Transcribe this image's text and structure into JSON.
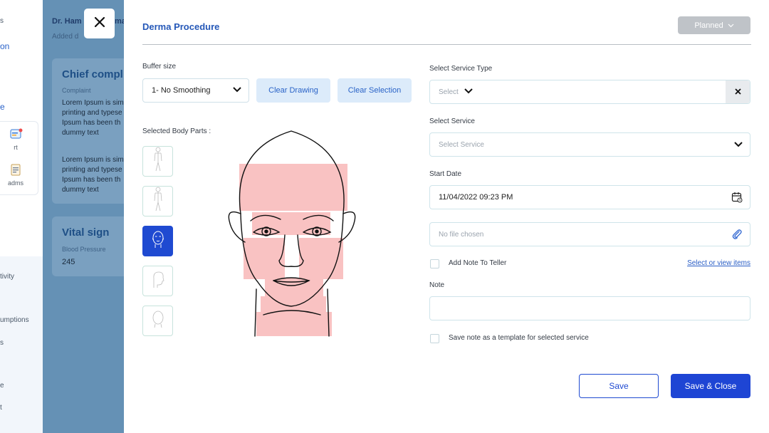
{
  "background": {
    "sidebar": {
      "fragments": [
        "s",
        "on",
        "e",
        "tivity",
        "umptions",
        "s",
        "e",
        "t"
      ],
      "items": [
        {
          "icon": "report-icon",
          "label": "rt"
        },
        {
          "icon": "document-icon",
          "label": "adms"
        }
      ]
    },
    "doctor_name": "Dr. Ham",
    "doctor_name_end": "ma",
    "added_label": "Added d",
    "chief_complaint": {
      "title": "Chief compl",
      "subtitle": "Complaint",
      "text_1": "Lorem Ipsum is sim printing and typese Ipsum has been th dummy text",
      "text_2": "Lorem Ipsum is sim printing and typese Ipsum has been th dummy text"
    },
    "vital_sign": {
      "title": "Vital sign",
      "subtitle": "Blood Pressure",
      "value": "245"
    }
  },
  "modal": {
    "title": "Derma Procedure",
    "status": "Planned",
    "buffer_size_label": "Buffer size",
    "buffer_size_value": "1- No Smoothing",
    "clear_drawing": "Clear Drawing",
    "clear_selection": "Clear Selection",
    "selected_body_parts_label": "Selected Body Parts :",
    "body_part_thumbs": [
      "full-body-front-icon",
      "full-body-back-icon",
      "face-front-icon",
      "head-side-icon",
      "head-back-icon"
    ],
    "service_type_label": "Select Service Type",
    "service_type_placeholder": "Select",
    "service_label": "Select Service",
    "service_placeholder": "Select Service",
    "start_date_label": "Start Date",
    "start_date_value": "11/04/2022 09:23 PM",
    "file_placeholder": "No file chosen",
    "add_note_teller": "Add Note To Teller",
    "select_view_items": "Select or view items",
    "note_label": "Note",
    "note_value": "",
    "save_template_label": "Save note as a template for selected service",
    "save_label": "Save",
    "save_close_label": "Save & Close"
  },
  "colors": {
    "accent": "#1e45d4",
    "title": "#2558b8",
    "overlay": "#6591b5",
    "highlight": "#f9c2c2"
  }
}
